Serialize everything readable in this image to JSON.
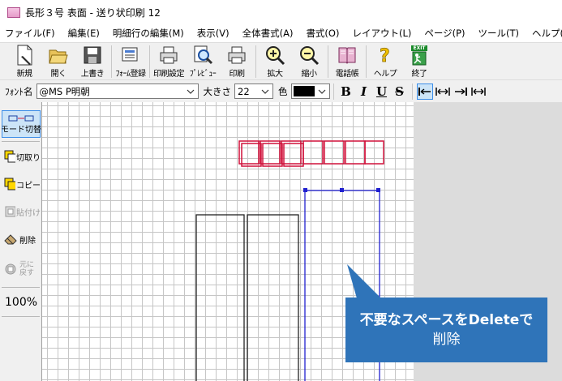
{
  "window": {
    "title": "長形３号 表面 - 送り状印刷 12"
  },
  "menu": [
    "ファイル(F)",
    "編集(E)",
    "明細行の編集(M)",
    "表示(V)",
    "全体書式(A)",
    "書式(O)",
    "レイアウト(L)",
    "ページ(P)",
    "ツール(T)",
    "ヘルプ(H)"
  ],
  "toolbar": {
    "new": "新規",
    "open": "開く",
    "overwrite": "上書き",
    "form_register": "ﾌｫｰﾑ登録",
    "print_settings": "印刷設定",
    "preview": "ﾌﾟﾚﾋﾞｭｰ",
    "print": "印刷",
    "zoom_in": "拡大",
    "zoom_out": "縮小",
    "phonebook": "電話帳",
    "help": "ヘルプ",
    "exit": "終了",
    "exit_badge": "EXIT"
  },
  "format": {
    "font_label": "ﾌｫﾝﾄ名",
    "font_value": "@MS P明朝",
    "size_label": "大きさ",
    "size_value": "22",
    "color_label": "色",
    "color_value": "#000000",
    "bold": "B",
    "italic": "I",
    "underline": "U",
    "strike": "S"
  },
  "sidebar": {
    "mode_switch": "モード切替",
    "cut": "切取り",
    "copy": "コピー",
    "paste": "貼付け",
    "delete": "削除",
    "undo_line1": "元に",
    "undo_line2": "戻す",
    "zoom": "100%"
  },
  "callout": {
    "line1": "不要なスペースをDeleteで",
    "line2": "削除"
  },
  "colors": {
    "selection_red": "#d0103a",
    "selection_blue": "#2020d0",
    "callout_bg": "#2f74b9",
    "toolbar_active": "#cce4f7"
  }
}
